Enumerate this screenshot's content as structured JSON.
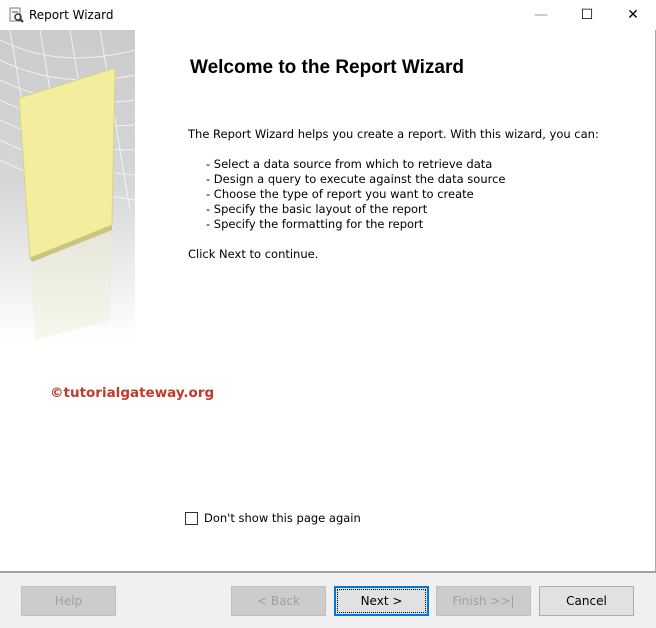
{
  "window": {
    "title": "Report Wizard",
    "minimize": "—",
    "maximize": "☐",
    "close": "✕"
  },
  "page": {
    "heading": "Welcome to the Report Wizard",
    "intro": "The Report Wizard helps you create a report. With this wizard, you can:",
    "items": [
      "- Select a data source from which to retrieve data",
      "- Design a query to execute against the data source",
      "- Choose the type of report you want to create",
      "- Specify the basic layout of the report",
      "- Specify the formatting for the report"
    ],
    "continue": "Click Next to continue.",
    "watermark": "©tutorialgateway.org",
    "checkbox_label": "Don't show this page again",
    "checkbox_checked": false
  },
  "buttons": {
    "help": "Help",
    "back": "< Back",
    "next": "Next >",
    "finish": "Finish >>|",
    "cancel": "Cancel"
  }
}
